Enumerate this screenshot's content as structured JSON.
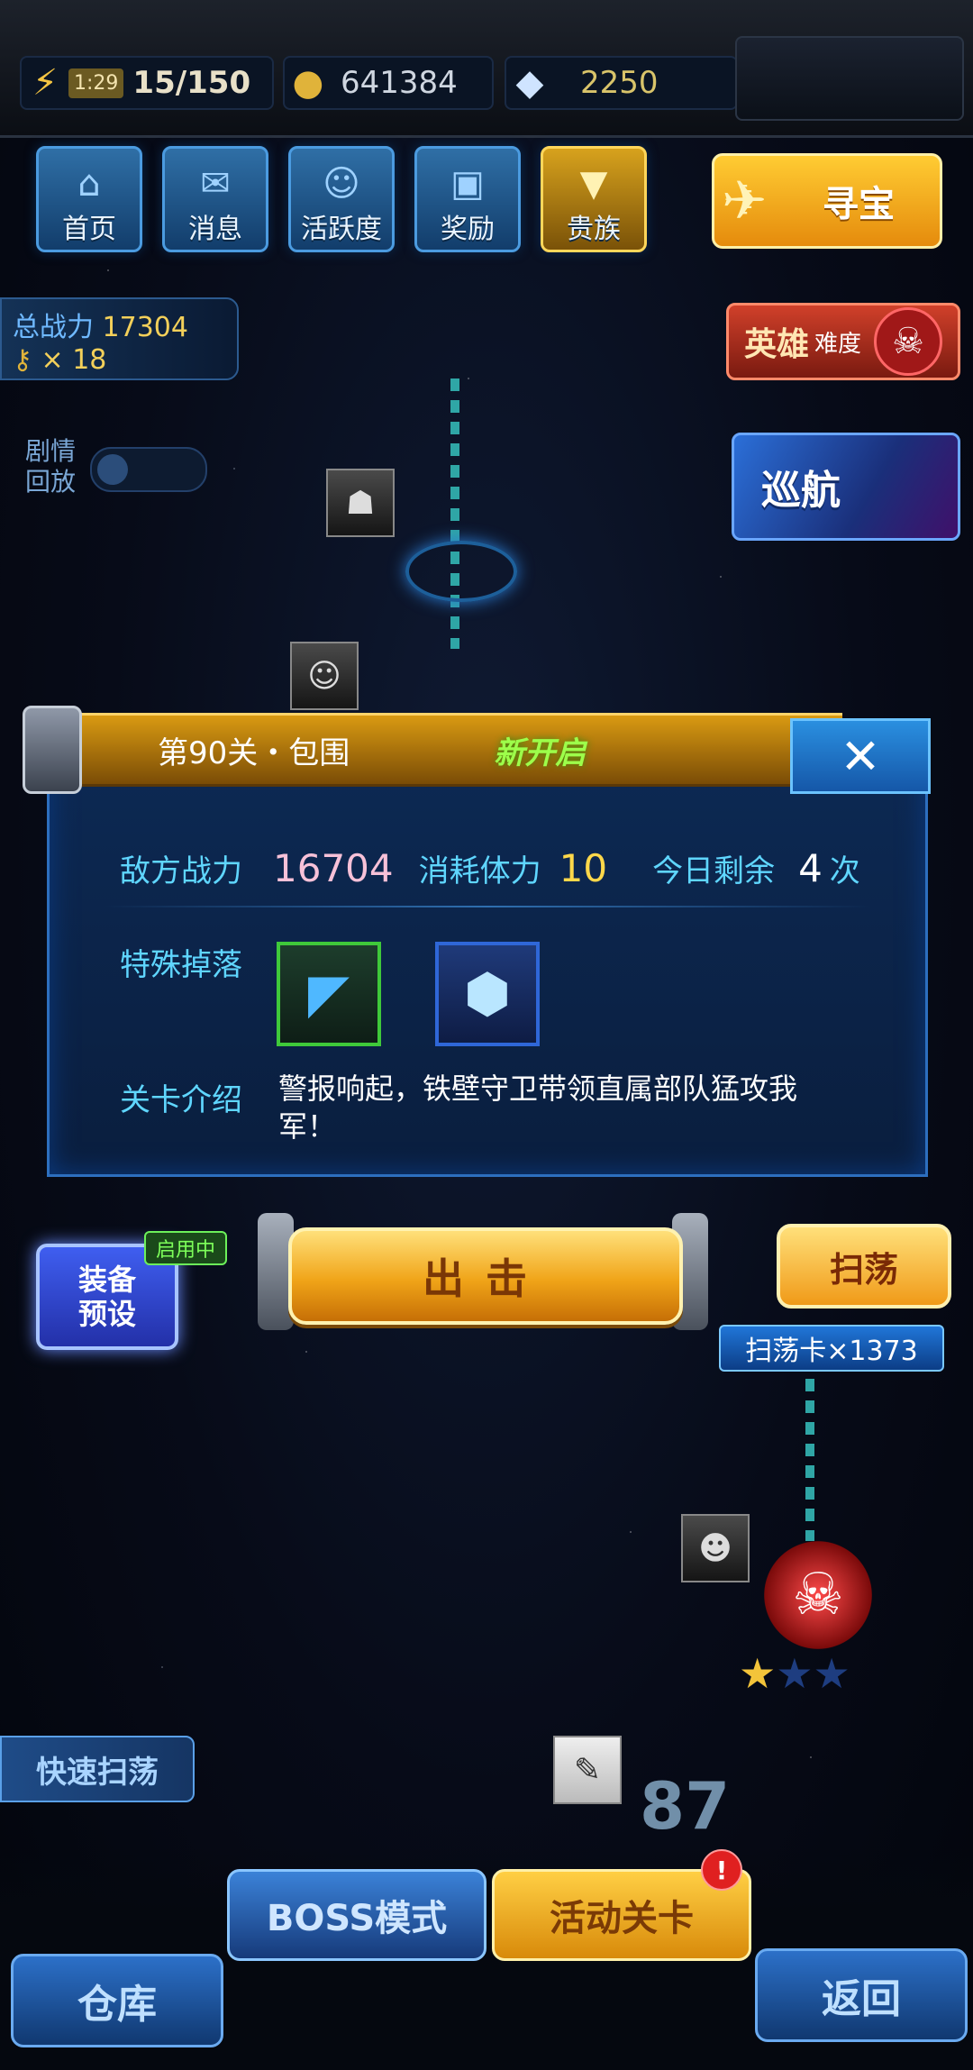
{
  "resources": {
    "energy_timer": "1:29",
    "energy": "15/150",
    "coins": "641384",
    "gems": "2250"
  },
  "menu": {
    "items": [
      {
        "label": "首页",
        "icon": "home-icon"
      },
      {
        "label": "消息",
        "icon": "mail-icon"
      },
      {
        "label": "活跃度",
        "icon": "activity-icon"
      },
      {
        "label": "奖励",
        "icon": "gift-icon"
      },
      {
        "label": "贵族",
        "icon": "noble-icon"
      }
    ],
    "treasure_label": "寻宝"
  },
  "power": {
    "label": "总战力",
    "value": "17304",
    "keys": "× 18"
  },
  "difficulty": {
    "label": "英雄",
    "suffix": "难度"
  },
  "cruise": {
    "label": "巡航"
  },
  "replay": {
    "label": "剧情回放"
  },
  "dialog": {
    "title": "第90关・包围",
    "status": "新开启",
    "close_glyph": "✕",
    "enemy_power_label": "敌方战力",
    "enemy_power": "16704",
    "stamina_label": "消耗体力",
    "stamina": "10",
    "remaining_label": "今日剩余",
    "remaining": "4",
    "remaining_unit": "次",
    "drop_label": "特殊掉落",
    "intro_label": "关卡介绍",
    "intro_text": "警报响起，铁壁守卫带领直属部队猛攻我军！"
  },
  "actions": {
    "preset_badge": "启用中",
    "preset_label": "装备预设",
    "attack_label": "出击",
    "sweep_label": "扫荡",
    "sweep_card": "扫荡卡×1373"
  },
  "map": {
    "quick_sweep": "快速扫荡",
    "stage_number": "87",
    "stars": {
      "earned": 1,
      "total": 3
    }
  },
  "bottom": {
    "boss_mode": "BOSS模式",
    "event_stage": "活动关卡",
    "notice": "!",
    "warehouse": "仓库",
    "back": "返回"
  },
  "colors": {
    "accent_blue": "#2d6fbf",
    "gold": "#f0a418",
    "new_green": "#9dff4a",
    "label_cyan": "#5fd6ff"
  }
}
